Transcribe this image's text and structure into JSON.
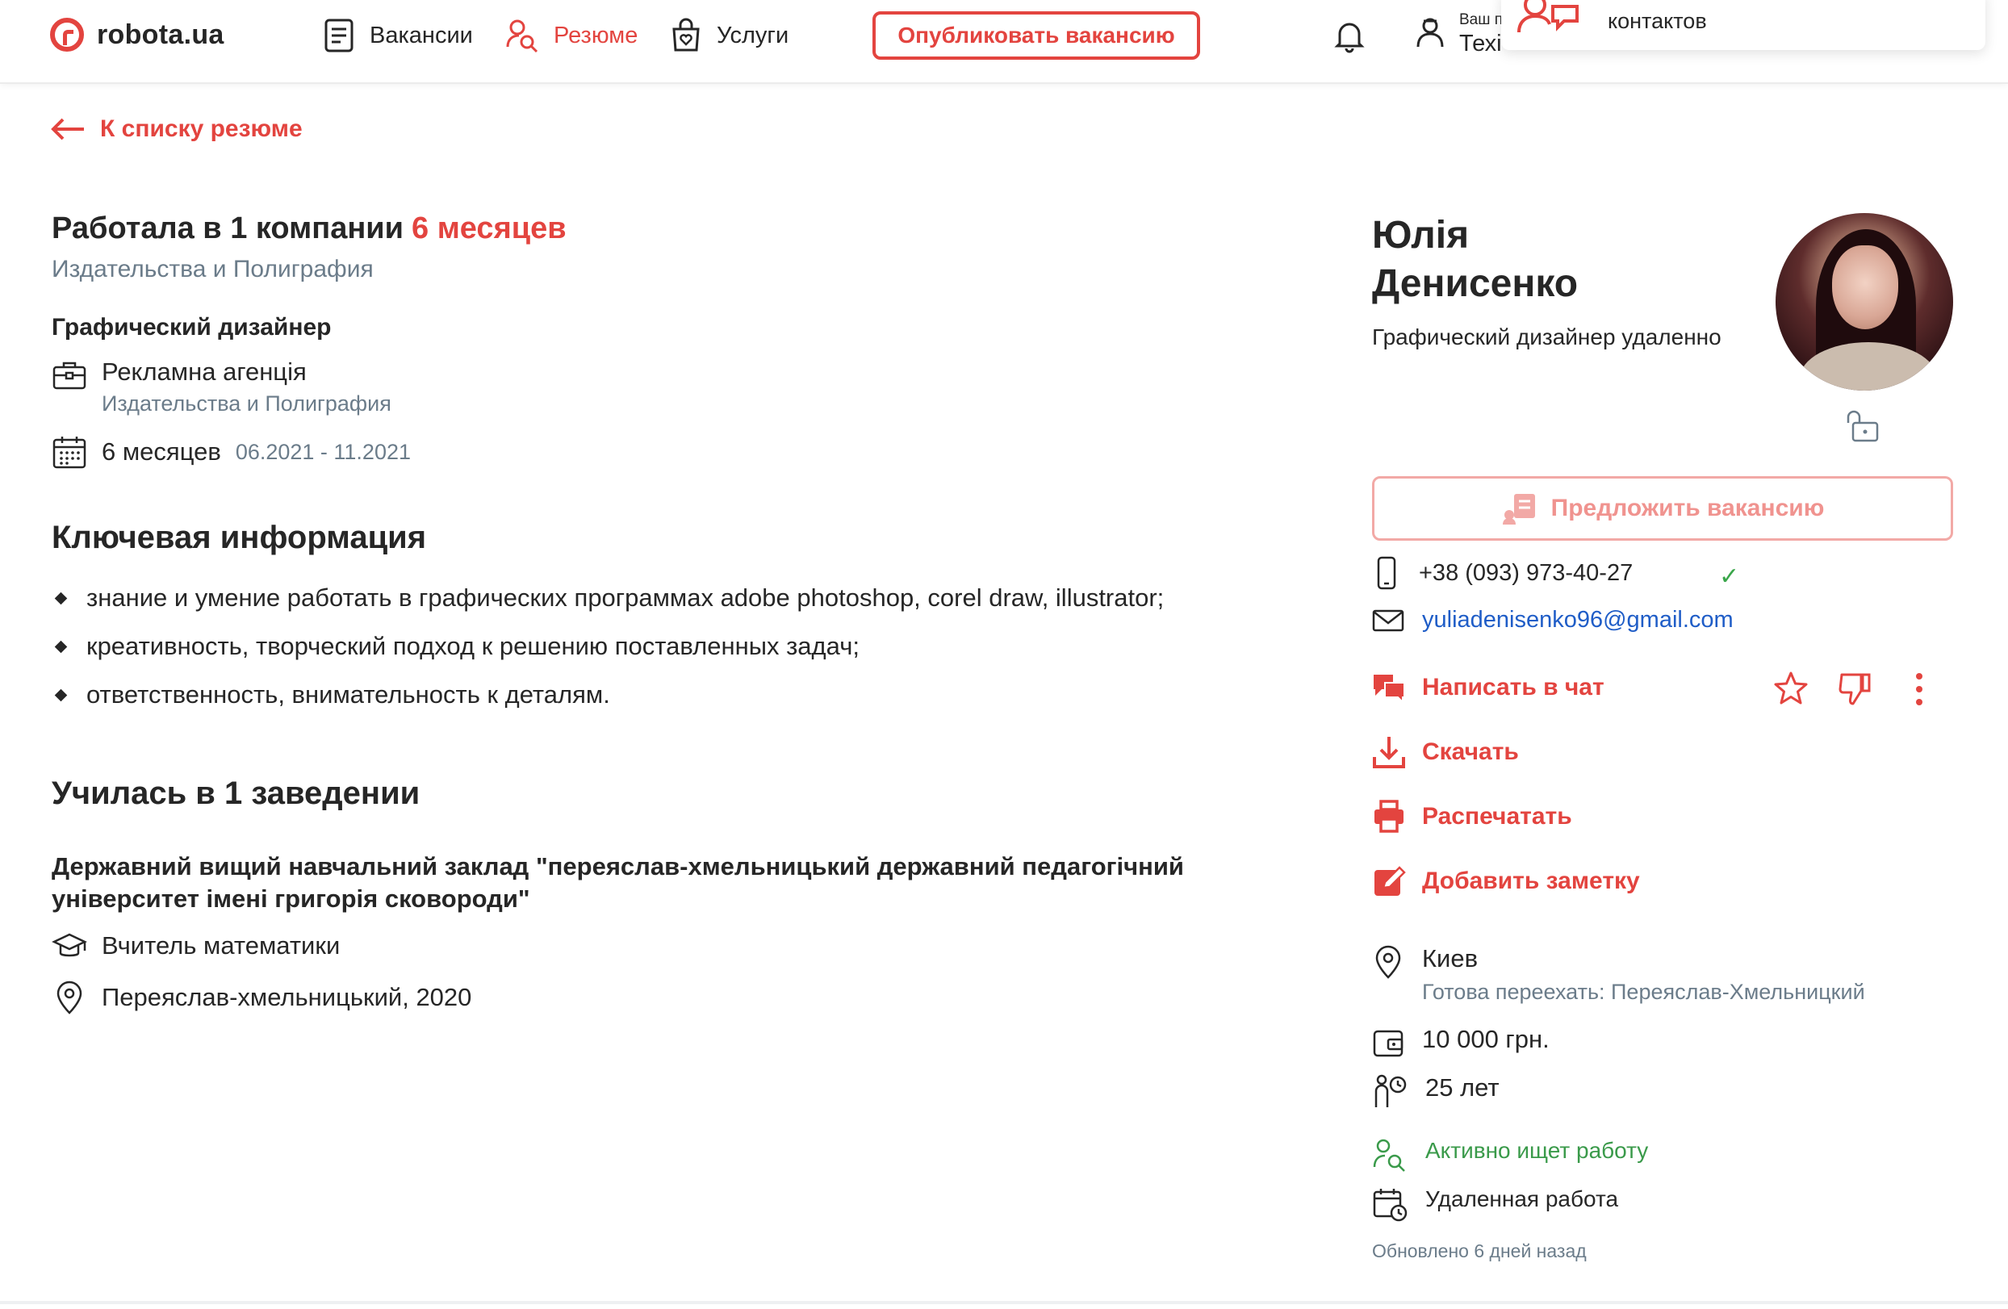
{
  "header": {
    "logo_text": "robota.ua",
    "nav": {
      "vacancies": "Вакансии",
      "resumes": "Резюме",
      "services": "Услуги"
    },
    "publish_button": "Опубликовать вакансию",
    "account_small": "Ваш п",
    "account_name": "Техі",
    "popup_text": "контактов"
  },
  "back_link": "К списку резюме",
  "experience": {
    "heading": "Работала в 1 компании",
    "duration": "6 месяцев",
    "industry": "Издательства и Полиграфия",
    "job_title": "Графический дизайнер",
    "company": "Рекламна агенція",
    "company_industry": "Издательства и Полиграфия",
    "period_length": "6 месяцев",
    "period_dates": "06.2021 - 11.2021"
  },
  "key_info": {
    "heading": "Ключевая информация",
    "items": [
      "знание и умение работать в графических программах adobe photoshop, corel draw, illustrator;",
      "креативность, творческий подход к решению поставленных задач;",
      "ответственность, внимательность к деталям."
    ]
  },
  "education": {
    "heading": "Училась в 1 заведении",
    "institution": "Державний вищий навчальний заклад \"переяслав-хмельницький державний педагогічний університет імені григорія сковороди\"",
    "specialty": "Вчитель математики",
    "location_year": "Переяслав-хмельницький, 2020"
  },
  "profile": {
    "first_name": "Юлія",
    "last_name": "Денисенко",
    "position": "Графический дизайнер удаленно",
    "offer_button": "Предложить вакансию",
    "phone": "+38 (093) 973-40-27",
    "phone_verified": "✓",
    "email": "yuliadenisenko96@gmail.com",
    "actions": {
      "chat": "Написать в чат",
      "download": "Скачать",
      "print": "Распечатать",
      "note": "Добавить заметку"
    },
    "city": "Киев",
    "relocation": "Готова переехать: Переяслав-Хмельницкий",
    "salary": "10 000 грн.",
    "age": "25 лет",
    "status": "Активно ищет работу",
    "work_type": "Удаленная работа",
    "updated": "Обновлено 6 дней назад"
  },
  "colors": {
    "accent": "#e3443f",
    "text": "#262626",
    "muted": "#6b7c8a",
    "link": "#1f5dc7",
    "green": "#3a9a4a"
  }
}
